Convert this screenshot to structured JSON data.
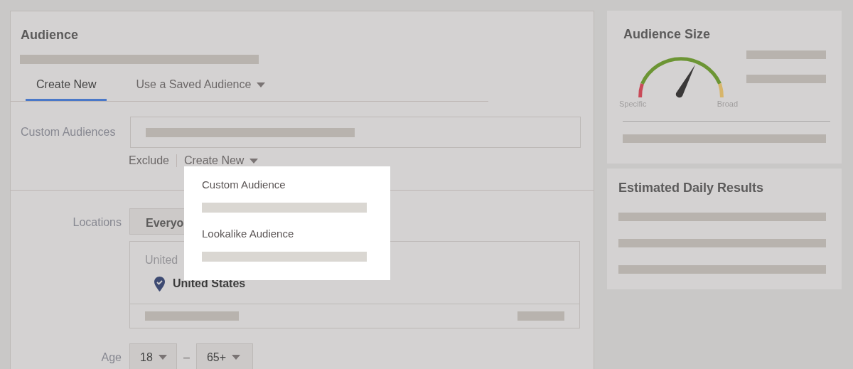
{
  "audience": {
    "title": "Audience",
    "tabs": [
      {
        "label": "Create New",
        "selected": true,
        "has_menu": false
      },
      {
        "label": "Use a Saved Audience",
        "selected": false,
        "has_menu": true
      }
    ],
    "custom_audiences": {
      "label": "Custom Audiences",
      "exclude": "Exclude",
      "create": "Create New"
    },
    "locations": {
      "label": "Locations",
      "button": "Everyo",
      "hint": "United",
      "location": "United States"
    },
    "age": {
      "label": "Age",
      "min": "18",
      "separator": "–",
      "max": "65+"
    }
  },
  "menu": {
    "items": [
      "Custom Audience",
      "Lookalike Audience"
    ]
  },
  "audience_size": {
    "title": "Audience Size",
    "gauge_labels": [
      "Specific",
      "Broad"
    ]
  },
  "estimated": {
    "title": "Estimated Daily Results"
  }
}
